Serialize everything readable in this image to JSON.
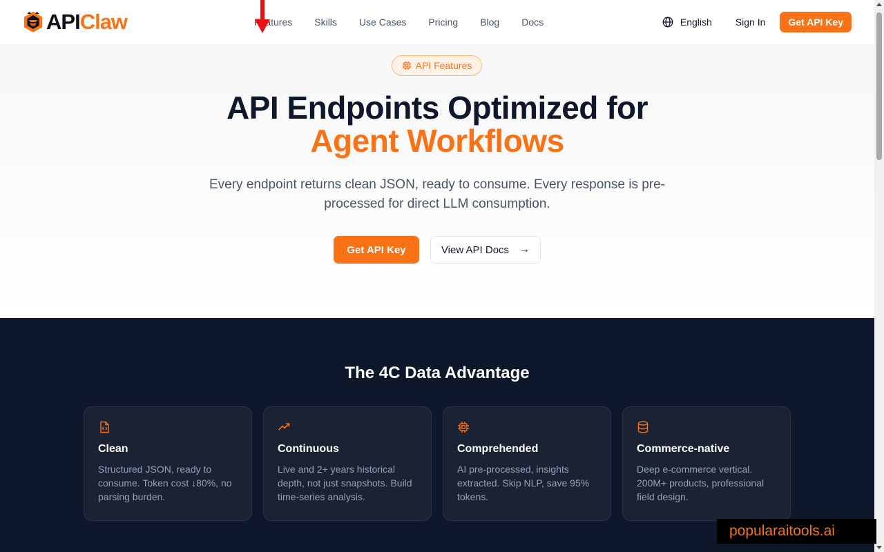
{
  "brand": {
    "part1": "API",
    "part2": "Claw"
  },
  "nav": {
    "items": [
      {
        "label": "Features"
      },
      {
        "label": "Skills"
      },
      {
        "label": "Use Cases"
      },
      {
        "label": "Pricing"
      },
      {
        "label": "Blog"
      },
      {
        "label": "Docs"
      }
    ],
    "language": "English",
    "signin": "Sign In",
    "cta": "Get API Key"
  },
  "hero": {
    "badge": "API Features",
    "title_line1": "API Endpoints Optimized for",
    "title_line2": "Agent Workflows",
    "subtitle": "Every endpoint returns clean JSON, ready to consume. Every response is pre-processed for direct LLM consumption.",
    "primary_button": "Get API Key",
    "secondary_button": "View API Docs"
  },
  "advantage": {
    "title": "The 4C Data Advantage",
    "cards": [
      {
        "icon": "file-code-icon",
        "title": "Clean",
        "desc": "Structured JSON, ready to consume. Token cost ↓80%, no parsing burden."
      },
      {
        "icon": "trending-up-icon",
        "title": "Continuous",
        "desc": "Live and 2+ years historical depth, not just snapshots. Build time-series analysis."
      },
      {
        "icon": "cpu-icon",
        "title": "Comprehended",
        "desc": "AI pre-processed, insights extracted. Skip NLP, save 95% tokens."
      },
      {
        "icon": "database-icon",
        "title": "Commerce-native",
        "desc": "Deep e-commerce vertical. 200M+ products, professional field design."
      }
    ]
  },
  "watermark": "popularaitools.ai",
  "colors": {
    "accent": "#f97316",
    "dark_bg": "#0f172a",
    "card_bg": "#1a2233"
  }
}
